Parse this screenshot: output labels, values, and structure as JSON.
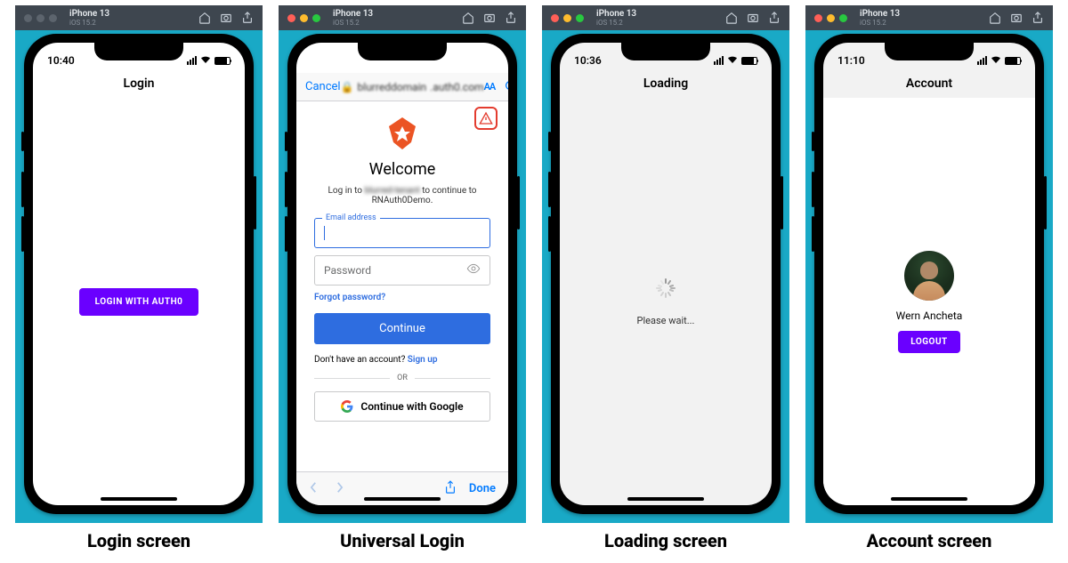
{
  "simulator": {
    "device": "iPhone 13",
    "ios": "iOS 15.2"
  },
  "screens": {
    "login": {
      "time": "10:40",
      "title": "Login",
      "button": "LOGIN WITH AUTH0",
      "caption": "Login screen"
    },
    "universal": {
      "caption": "Universal Login",
      "cancel": "Cancel",
      "domain_suffix": ".auth0.com",
      "aa": "AA",
      "welcome": "Welcome",
      "subtext_prefix": "Log in to ",
      "subtext_suffix": " to continue to RNAuth0Demo.",
      "email_label": "Email address",
      "password_placeholder": "Password",
      "forgot": "Forgot password?",
      "continue": "Continue",
      "no_account": "Don't have an account?  ",
      "signup": "Sign up",
      "or": "OR",
      "google": "Continue with Google",
      "done": "Done"
    },
    "loading": {
      "time": "10:36",
      "title": "Loading",
      "please": "Please wait...",
      "caption": "Loading screen"
    },
    "account": {
      "time": "11:10",
      "title": "Account",
      "username": "Wern Ancheta",
      "logout": "LOGOUT",
      "caption": "Account screen"
    }
  }
}
